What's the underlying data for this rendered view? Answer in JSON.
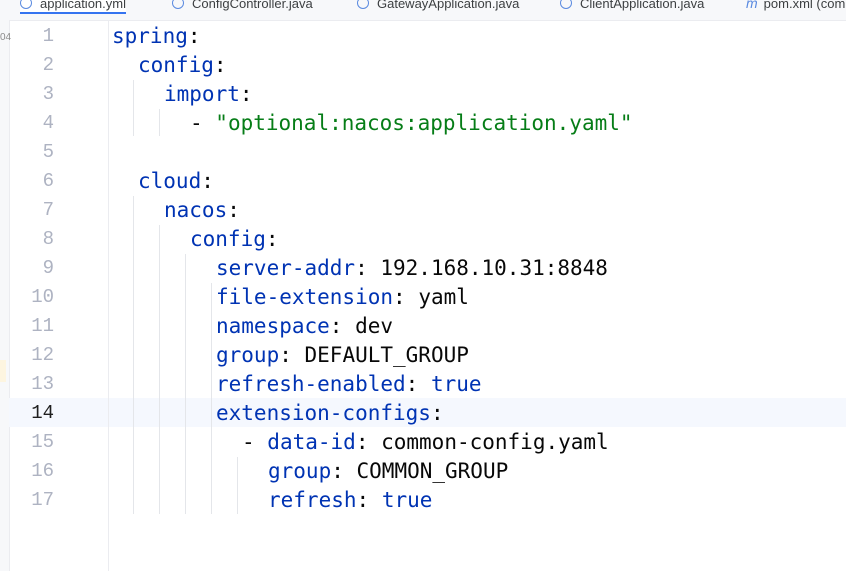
{
  "tabs": [
    {
      "label": "application.yml",
      "icon": "yaml-file-icon",
      "active": true
    },
    {
      "label": "ConfigController.java",
      "icon": "java-class-icon",
      "active": false
    },
    {
      "label": "GatewayApplication.java",
      "icon": "java-class-icon",
      "active": false
    },
    {
      "label": "ClientApplication.java",
      "icon": "java-class-icon",
      "active": false
    },
    {
      "label": "pom.xml (com",
      "icon": "maven-icon",
      "active": false
    }
  ],
  "gutter_fragment": "04",
  "current_line": 14,
  "lines": [
    {
      "num": "1",
      "key": "spring",
      "punct": ":",
      "value": "",
      "value_type": ""
    },
    {
      "num": "2",
      "key": "config",
      "punct": ":",
      "value": "",
      "value_type": ""
    },
    {
      "num": "3",
      "key": "import",
      "punct": ":",
      "value": "",
      "value_type": ""
    },
    {
      "num": "4",
      "key": "",
      "punct": "- ",
      "value": "\"optional:nacos:application.yaml\"",
      "value_type": "string"
    },
    {
      "num": "5",
      "key": "",
      "punct": "",
      "value": "",
      "value_type": ""
    },
    {
      "num": "6",
      "key": "cloud",
      "punct": ":",
      "value": "",
      "value_type": ""
    },
    {
      "num": "7",
      "key": "nacos",
      "punct": ":",
      "value": "",
      "value_type": ""
    },
    {
      "num": "8",
      "key": "config",
      "punct": ":",
      "value": "",
      "value_type": ""
    },
    {
      "num": "9",
      "key": "server-addr",
      "punct": ": ",
      "value": "192.168.10.31:8848",
      "value_type": "plain"
    },
    {
      "num": "10",
      "key": "file-extension",
      "punct": ": ",
      "value": "yaml",
      "value_type": "plain"
    },
    {
      "num": "11",
      "key": "namespace",
      "punct": ": ",
      "value": "dev",
      "value_type": "plain"
    },
    {
      "num": "12",
      "key": "group",
      "punct": ": ",
      "value": "DEFAULT_GROUP",
      "value_type": "plain"
    },
    {
      "num": "13",
      "key": "refresh-enabled",
      "punct": ": ",
      "value": "true",
      "value_type": "keyword"
    },
    {
      "num": "14",
      "key": "extension-configs",
      "punct": ":",
      "value": "",
      "value_type": ""
    },
    {
      "num": "15",
      "key": "data-id",
      "punct": ": ",
      "value": "common-config.yaml",
      "value_type": "plain",
      "dash": "- "
    },
    {
      "num": "16",
      "key": "group",
      "punct": ": ",
      "value": "COMMON_GROUP",
      "value_type": "plain"
    },
    {
      "num": "17",
      "key": "refresh",
      "punct": ": ",
      "value": "true",
      "value_type": "keyword"
    }
  ],
  "colors": {
    "key": "#0033b3",
    "string": "#067d17",
    "plain": "#080808",
    "line_number": "#aeb3c2",
    "current_line_bg": "#f5f8fe"
  }
}
